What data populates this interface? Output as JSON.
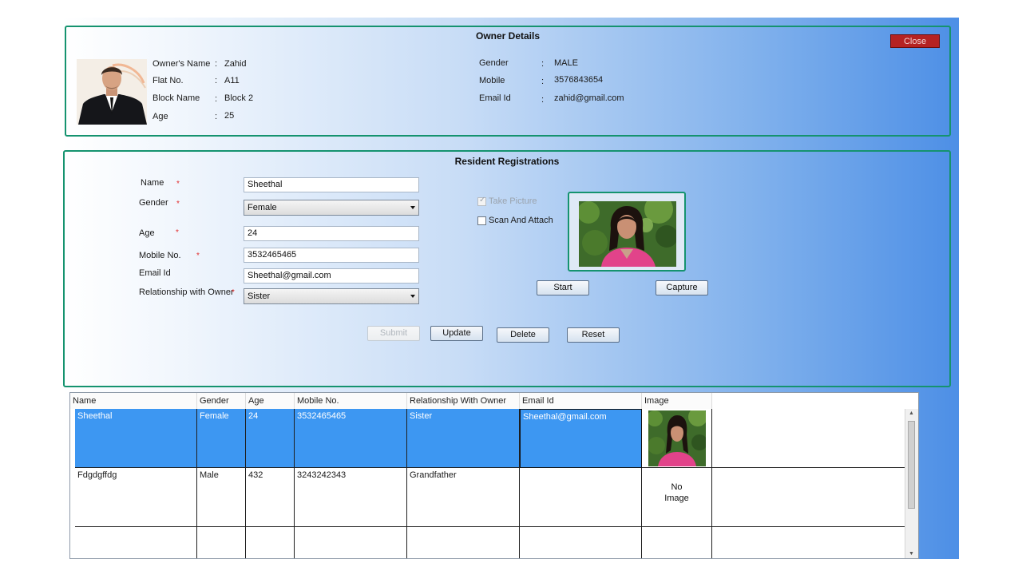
{
  "owner": {
    "title": "Owner Details",
    "close_label": "Close",
    "fields_left": [
      {
        "label": "Owner's Name",
        "value": "Zahid"
      },
      {
        "label": "Flat No.",
        "value": "A11"
      },
      {
        "label": "Block Name",
        "value": "Block 2"
      },
      {
        "label": "Age",
        "value": "25"
      }
    ],
    "fields_right": [
      {
        "label": "Gender",
        "value": "MALE"
      },
      {
        "label": "Mobile",
        "value": "3576843654"
      },
      {
        "label": "Email Id",
        "value": "zahid@gmail.com"
      }
    ],
    "separator": ":"
  },
  "registration": {
    "title": "Resident Registrations",
    "required_mark": "*",
    "name": {
      "label": "Name",
      "value": "Sheethal"
    },
    "gender": {
      "label": "Gender",
      "value": "Female"
    },
    "age": {
      "label": "Age",
      "value": "24"
    },
    "mobile": {
      "label": "Mobile No.",
      "value": "3532465465"
    },
    "email": {
      "label": "Email Id",
      "value": "Sheethal@gmail.com"
    },
    "relationship": {
      "label": "Relationship with Owner",
      "value": "Sister"
    },
    "take_picture_label": "Take Picture",
    "take_picture_checked": true,
    "scan_attach_label": "Scan And Attach",
    "scan_attach_checked": false,
    "start_label": "Start",
    "capture_label": "Capture",
    "submit_label": "Submit",
    "update_label": "Update",
    "delete_label": "Delete",
    "reset_label": "Reset"
  },
  "grid": {
    "columns": [
      "Name",
      "Gender",
      "Age",
      "Mobile No.",
      "Relationship With Owner",
      "Email Id",
      "Image"
    ],
    "rows": [
      {
        "name": "Sheethal",
        "gender": "Female",
        "age": "24",
        "mobile": "3532465465",
        "relationship": "Sister",
        "email": "Sheethal@gmail.com",
        "image": "photo",
        "selected": true
      },
      {
        "name": "Fdgdgffdg",
        "gender": "Male",
        "age": "432",
        "mobile": "3243242343",
        "relationship": "Grandfather",
        "email": "",
        "image_text_1": "No",
        "image_text_2": "Image",
        "selected": false
      }
    ]
  },
  "colors": {
    "panel_border": "#15936f",
    "close_button": "#b52222",
    "selection": "#3d97f2"
  }
}
